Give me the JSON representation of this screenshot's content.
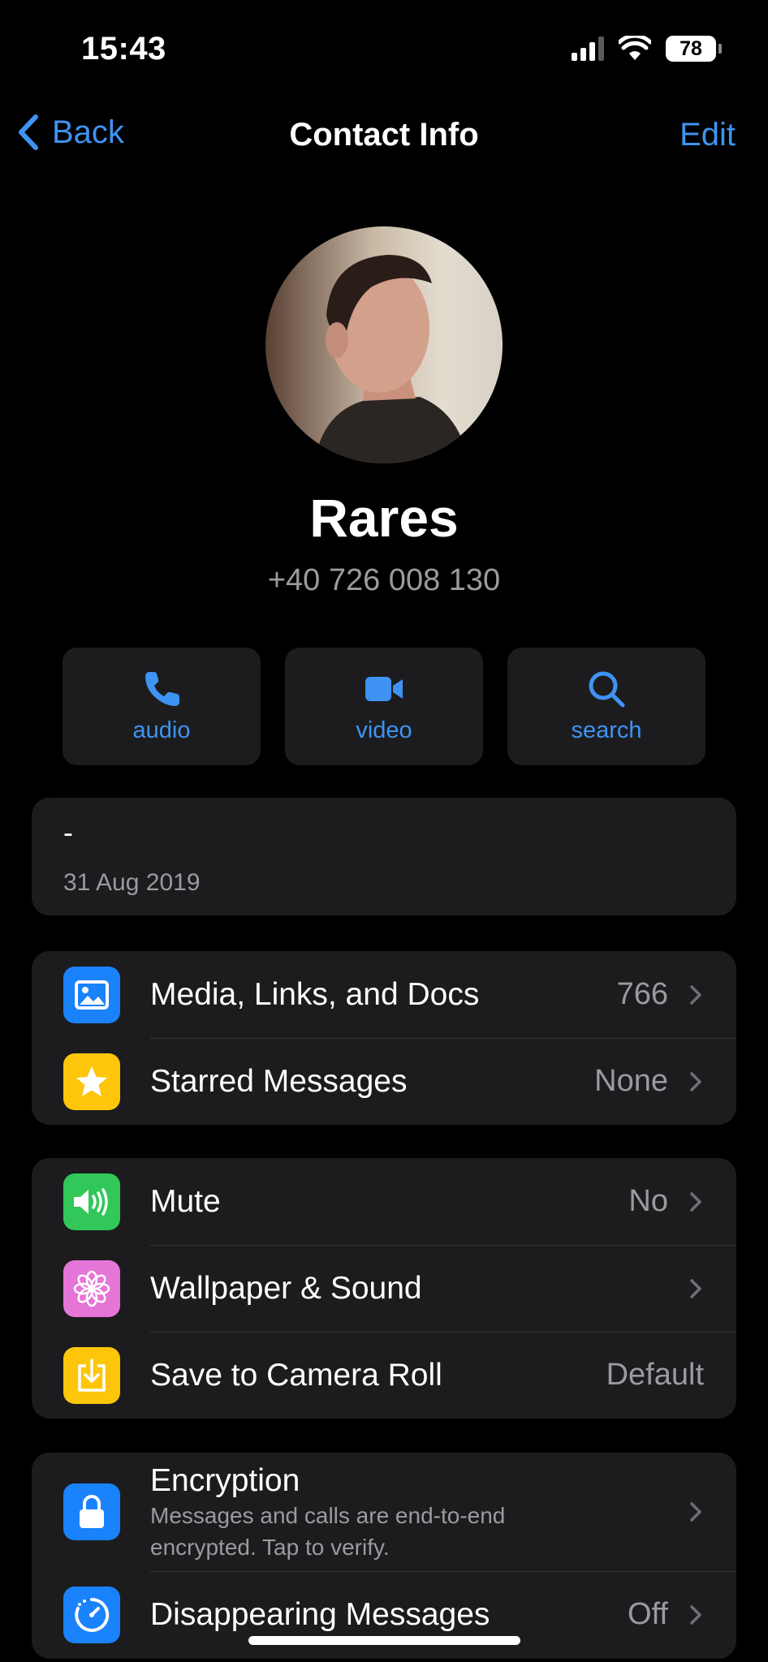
{
  "status_bar": {
    "time": "15:43",
    "battery": "78"
  },
  "nav": {
    "back_label": "Back",
    "title": "Contact Info",
    "edit_label": "Edit"
  },
  "profile": {
    "name": "Rares",
    "phone": "+40 726 008 130"
  },
  "actions": [
    {
      "label": "audio",
      "icon": "phone-icon"
    },
    {
      "label": "video",
      "icon": "video-camera-icon"
    },
    {
      "label": "search",
      "icon": "search-icon"
    }
  ],
  "about": {
    "text": "-",
    "date": "31 Aug 2019"
  },
  "group1": [
    {
      "label": "Media, Links, and Docs",
      "value": "766",
      "icon": "photo-icon",
      "color": "#1a82fb"
    },
    {
      "label": "Starred Messages",
      "value": "None",
      "icon": "star-icon",
      "color": "#fdc60a"
    }
  ],
  "group2": [
    {
      "label": "Mute",
      "value": "No",
      "icon": "speaker-icon",
      "color": "#31c759"
    },
    {
      "label": "Wallpaper & Sound",
      "value": "",
      "icon": "flower-icon",
      "color": "#e675d8"
    },
    {
      "label": "Save to Camera Roll",
      "value": "Default",
      "icon": "download-icon",
      "color": "#fdc60a"
    }
  ],
  "group3": [
    {
      "label": "Encryption",
      "subtitle": "Messages and calls are end-to-end encrypted. Tap to verify.",
      "icon": "lock-icon",
      "color": "#1a82fb"
    },
    {
      "label": "Disappearing Messages",
      "value": "Off",
      "icon": "timer-icon",
      "color": "#1a82fb"
    }
  ]
}
